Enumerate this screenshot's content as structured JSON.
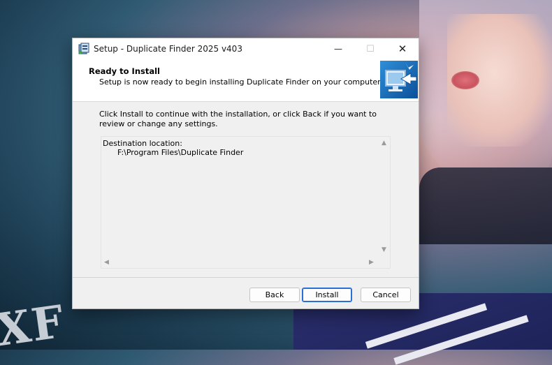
{
  "window": {
    "title": "Setup - Duplicate Finder 2025 v403",
    "minimize_glyph": "—",
    "maximize_glyph": "☐",
    "close_glyph": "✕"
  },
  "header": {
    "title": "Ready to Install",
    "subtitle": "Setup is now ready to begin installing Duplicate Finder on your computer."
  },
  "body": {
    "instructions": "Click Install to continue with the installation, or click Back if you want to review or change any settings."
  },
  "memo": {
    "lines": [
      "Destination location:",
      "      F:\\Program Files\\Duplicate Finder"
    ]
  },
  "buttons": {
    "back": "Back",
    "install": "Install",
    "cancel": "Cancel"
  },
  "wallpaper": {
    "watermark": "XF"
  },
  "colors": {
    "accent": "#2a6fd6",
    "dialog_bg": "#f0f0f0"
  },
  "icons": [
    "setup-app-icon",
    "installer-monitor-icon",
    "scroll-up-icon",
    "scroll-down-icon",
    "scroll-left-icon",
    "scroll-right-icon"
  ]
}
